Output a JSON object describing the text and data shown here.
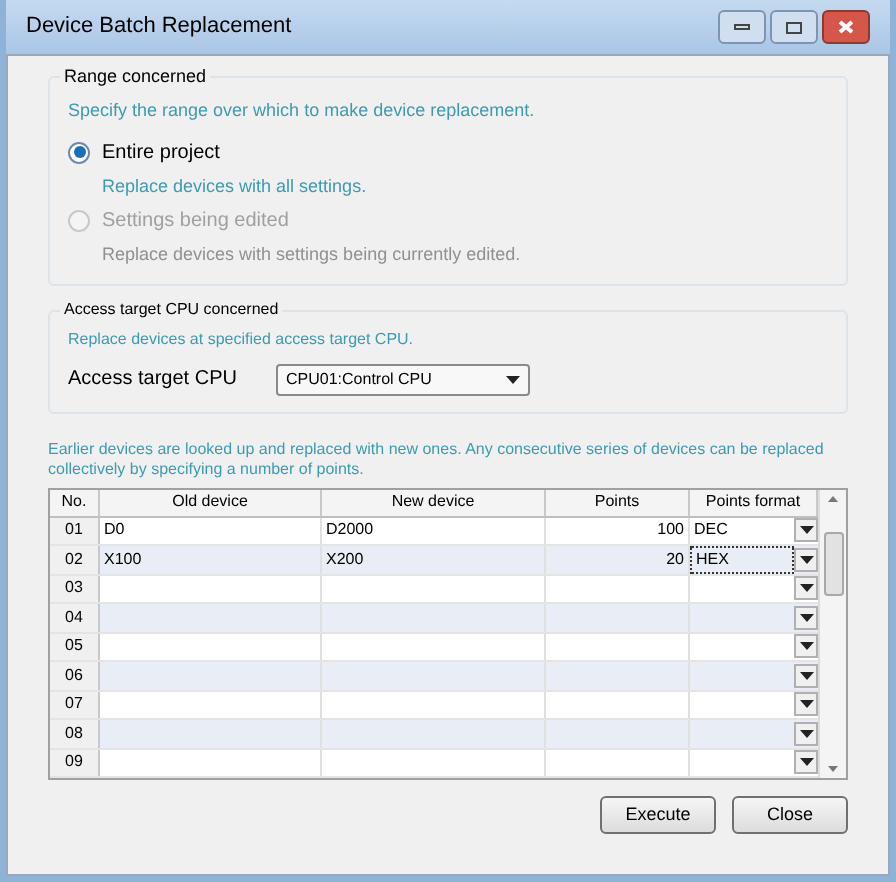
{
  "window": {
    "title": "Device Batch Replacement"
  },
  "range_group": {
    "title": "Range concerned",
    "hint": "Specify the range over which to make device replacement.",
    "options": [
      {
        "label": "Entire project",
        "description": "Replace devices with all settings.",
        "selected": true,
        "disabled": false
      },
      {
        "label": "Settings being edited",
        "description": "Replace devices with settings being currently edited.",
        "selected": false,
        "disabled": true
      }
    ]
  },
  "cpu_group": {
    "title": "Access target CPU concerned",
    "hint": "Replace devices at specified access target CPU.",
    "field_label": "Access target CPU",
    "value": "CPU01:Control CPU"
  },
  "note": "Earlier devices are looked up and replaced with new ones. Any consecutive series of devices can be replaced collectively by specifying a number of points.",
  "table": {
    "columns": [
      "No.",
      "Old device",
      "New device",
      "Points",
      "Points format"
    ],
    "rows": [
      {
        "no": "01",
        "old": "D0",
        "new": "D2000",
        "points": "100",
        "format": "DEC",
        "selected": false
      },
      {
        "no": "02",
        "old": "X100",
        "new": "X200",
        "points": "20",
        "format": "HEX",
        "selected": true
      },
      {
        "no": "03",
        "selected": false
      },
      {
        "no": "04",
        "selected": false
      },
      {
        "no": "05",
        "selected": false
      },
      {
        "no": "06",
        "selected": false
      },
      {
        "no": "07",
        "selected": false
      },
      {
        "no": "08",
        "selected": false
      },
      {
        "no": "09",
        "selected": false
      }
    ]
  },
  "buttons": [
    "Execute",
    "Close"
  ]
}
